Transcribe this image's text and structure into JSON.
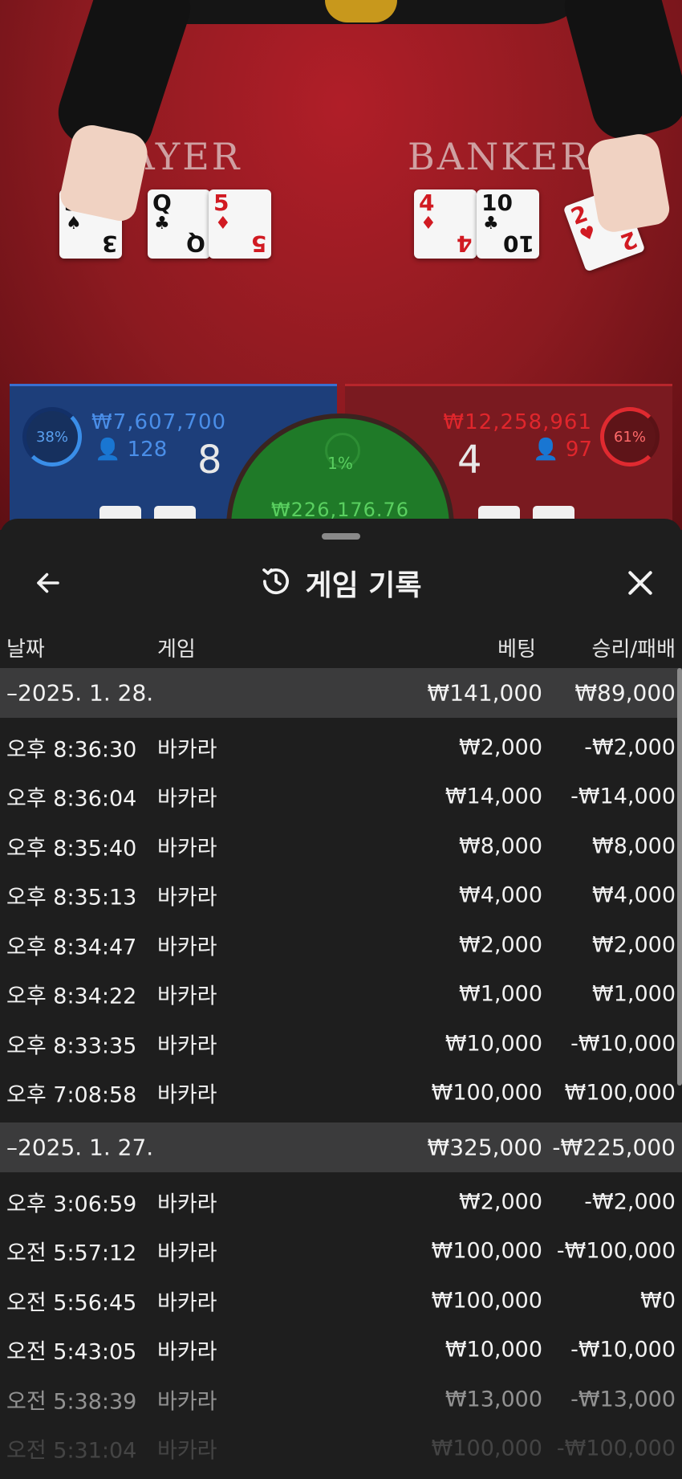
{
  "video": {
    "player_label": "PLAYER",
    "banker_label": "BANKER",
    "player_cards": [
      {
        "rank": "3",
        "suit": "♠",
        "color": "blk"
      },
      {
        "rank": "Q",
        "suit": "♣",
        "color": "blk"
      },
      {
        "rank": "5",
        "suit": "♦",
        "color": "red"
      }
    ],
    "banker_cards": [
      {
        "rank": "4",
        "suit": "♦",
        "color": "red"
      },
      {
        "rank": "10",
        "suit": "♣",
        "color": "blk"
      },
      {
        "rank": "2",
        "suit": "♥",
        "color": "red"
      }
    ],
    "player": {
      "percent": "38%",
      "amount": "₩7,607,700",
      "count": "128",
      "score": "8"
    },
    "banker": {
      "percent": "61%",
      "amount": "₩12,258,961",
      "count": "97",
      "score": "4"
    },
    "tie": {
      "percent": "1%",
      "amount": "₩226,176.76"
    }
  },
  "sheet": {
    "title": "게임 기록",
    "columns": {
      "date": "날짜",
      "game": "게임",
      "bet": "베팅",
      "result": "승리/패배"
    }
  },
  "groups": [
    {
      "date": "–2025. 1. 28.",
      "bet_total": "₩141,000",
      "result_total": "₩89,000",
      "rows": [
        {
          "time": "오후 8:36:30",
          "game": "바카라",
          "bet": "₩2,000",
          "result": "-₩2,000"
        },
        {
          "time": "오후 8:36:04",
          "game": "바카라",
          "bet": "₩14,000",
          "result": "-₩14,000"
        },
        {
          "time": "오후 8:35:40",
          "game": "바카라",
          "bet": "₩8,000",
          "result": "₩8,000"
        },
        {
          "time": "오후 8:35:13",
          "game": "바카라",
          "bet": "₩4,000",
          "result": "₩4,000"
        },
        {
          "time": "오후 8:34:47",
          "game": "바카라",
          "bet": "₩2,000",
          "result": "₩2,000"
        },
        {
          "time": "오후 8:34:22",
          "game": "바카라",
          "bet": "₩1,000",
          "result": "₩1,000"
        },
        {
          "time": "오후 8:33:35",
          "game": "바카라",
          "bet": "₩10,000",
          "result": "-₩10,000"
        },
        {
          "time": "오후 7:08:58",
          "game": "바카라",
          "bet": "₩100,000",
          "result": "₩100,000"
        }
      ]
    },
    {
      "date": "–2025. 1. 27.",
      "bet_total": "₩325,000",
      "result_total": "-₩225,000",
      "rows": [
        {
          "time": "오후 3:06:59",
          "game": "바카라",
          "bet": "₩2,000",
          "result": "-₩2,000"
        },
        {
          "time": "오전 5:57:12",
          "game": "바카라",
          "bet": "₩100,000",
          "result": "-₩100,000"
        },
        {
          "time": "오전 5:56:45",
          "game": "바카라",
          "bet": "₩100,000",
          "result": "₩0"
        },
        {
          "time": "오전 5:43:05",
          "game": "바카라",
          "bet": "₩10,000",
          "result": "-₩10,000"
        },
        {
          "time": "오전 5:38:39",
          "game": "바카라",
          "bet": "₩13,000",
          "result": "-₩13,000"
        },
        {
          "time": "오전 5:31:04",
          "game": "바카라",
          "bet": "₩100,000",
          "result": "-₩100,000"
        }
      ]
    }
  ]
}
